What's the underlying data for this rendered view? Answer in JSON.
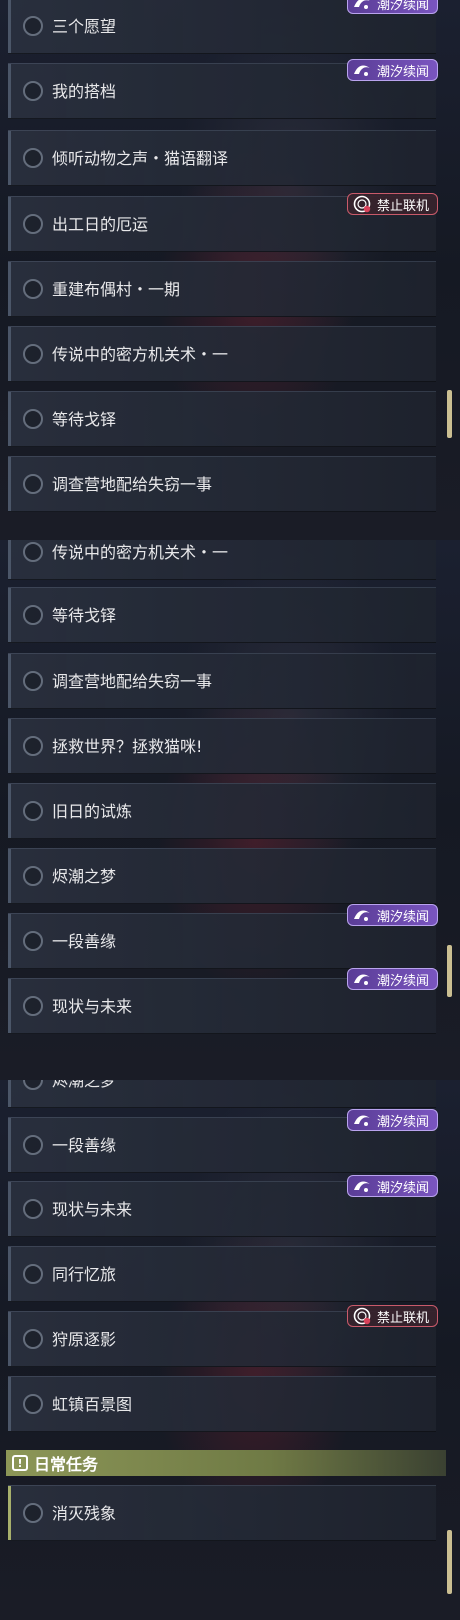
{
  "badges": {
    "tide": "潮汐续闻",
    "ban": "禁止联机"
  },
  "colors": {
    "tide_badge": "#6a48aa",
    "ban_badge_border": "#c95a6a",
    "daily_accent": "#a7b06c"
  },
  "panel1": {
    "items": [
      {
        "title": "三个愿望",
        "badge": "潮汐续闻"
      },
      {
        "title": "我的搭档",
        "badge": "潮汐续闻"
      },
      {
        "title": "倾听动物之声・猫语翻译"
      },
      {
        "title": "出工日的厄运",
        "badge": "禁止联机"
      },
      {
        "title": "重建布偶村・一期"
      },
      {
        "title": "传说中的密方机关术・一"
      },
      {
        "title": "等待戈铎"
      },
      {
        "title": "调查营地配给失窃一事"
      }
    ]
  },
  "panel2": {
    "items": [
      {
        "title": "传说中的密方机关术・一"
      },
      {
        "title": "等待戈铎"
      },
      {
        "title": "调查营地配给失窃一事"
      },
      {
        "title": "拯救世界？拯救猫咪!"
      },
      {
        "title": "旧日的试炼"
      },
      {
        "title": "烬潮之梦"
      },
      {
        "title": "一段善缘",
        "badge": "潮汐续闻"
      },
      {
        "title": "现状与未来",
        "badge": "潮汐续闻"
      }
    ]
  },
  "panel3": {
    "items": [
      {
        "title": "烬潮之梦"
      },
      {
        "title": "一段善缘",
        "badge": "潮汐续闻"
      },
      {
        "title": "现状与未来",
        "badge": "潮汐续闻"
      },
      {
        "title": "同行忆旅"
      },
      {
        "title": "狩原逐影",
        "badge": "禁止联机"
      },
      {
        "title": "虹镇百景图"
      }
    ],
    "section_header": "日常任务",
    "daily_items": [
      {
        "title": "消灭残象"
      }
    ]
  }
}
